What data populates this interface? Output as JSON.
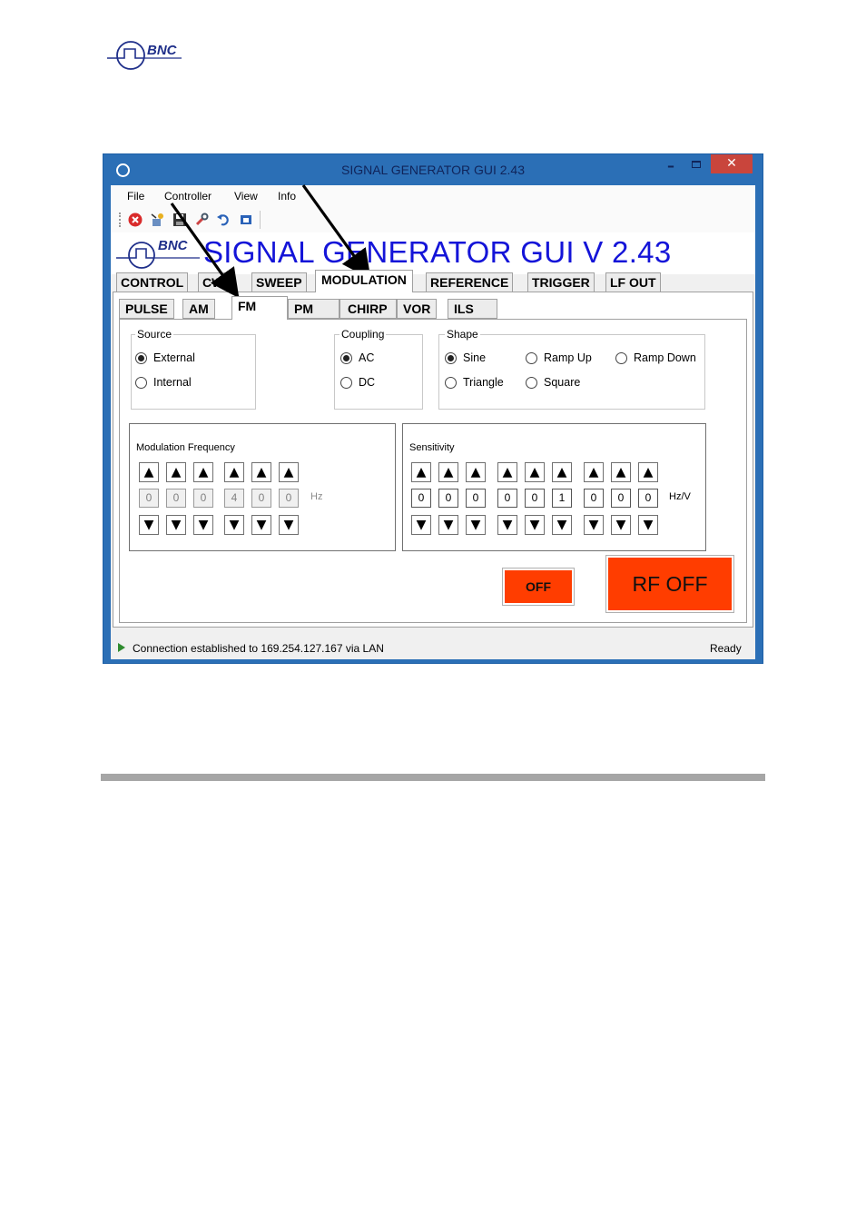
{
  "brand": {
    "name": "BNC"
  },
  "window": {
    "title": "SIGNAL GENERATOR GUI 2.43",
    "minimize": "–",
    "close": "✕"
  },
  "menu": [
    "File",
    "Controller",
    "View",
    "Info"
  ],
  "toolbar_icons": [
    "stop-icon",
    "connect-icon",
    "save-icon",
    "wrench-icon",
    "undo-icon",
    "window-icon"
  ],
  "banner": {
    "title": "SIGNAL GENERATOR GUI V 2.43",
    "logo_text": "BNC"
  },
  "main_tabs": [
    "CONTROL",
    "CW",
    "SWEEP",
    "MODULATION",
    "REFERENCE",
    "TRIGGER",
    "LF OUT"
  ],
  "main_tab_active": "MODULATION",
  "sub_tabs": [
    "PULSE",
    "AM",
    "FM",
    "PM",
    "CHIRP",
    "VOR",
    "ILS"
  ],
  "sub_tab_active": "FM",
  "source": {
    "label": "Source",
    "options": [
      "External",
      "Internal"
    ],
    "selected": "External"
  },
  "coupling": {
    "label": "Coupling",
    "options": [
      "AC",
      "DC"
    ],
    "selected": "AC"
  },
  "shape": {
    "label": "Shape",
    "options": [
      "Sine",
      "Ramp Up",
      "Ramp Down",
      "Triangle",
      "Square"
    ],
    "selected": "Sine"
  },
  "mod_frequency": {
    "label": "Modulation Frequency",
    "digits": [
      "0",
      "0",
      "0",
      "4",
      "0",
      "0"
    ],
    "unit": "Hz",
    "enabled": false
  },
  "sensitivity": {
    "label": "Sensitivity",
    "digits": [
      "0",
      "0",
      "0",
      "0",
      "0",
      "1",
      "0",
      "0",
      "0"
    ],
    "unit": "Hz/V"
  },
  "buttons": {
    "mod_off": "OFF",
    "rf_off": "RF OFF"
  },
  "status": {
    "message": "Connection established to 169.254.127.167 via LAN",
    "state": "Ready"
  },
  "colors": {
    "accent_button": "#ff3d00",
    "banner_text": "#1414d8",
    "window_frame": "#2b6fb6",
    "close_button": "#c9453c"
  },
  "arrow_glyphs": {
    "up": "▲",
    "down": "▼"
  }
}
